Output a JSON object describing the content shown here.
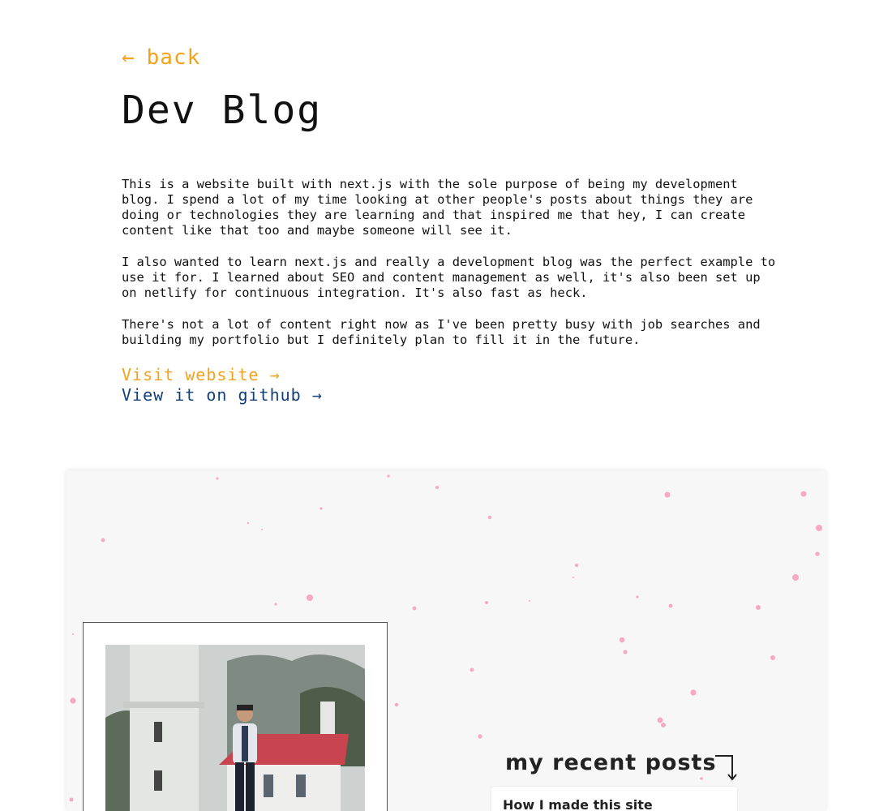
{
  "nav": {
    "back_arrow": "←",
    "back_label": "back"
  },
  "page": {
    "title": "Dev Blog"
  },
  "description": {
    "paragraphs": [
      "This is a website built with next.js with the sole purpose of being my development blog. I spend a lot of my time looking at other people's posts about things they are doing or technologies they are learning and that inspired me that hey, I can create content like that too and maybe someone will see it.",
      "I also wanted to learn next.js and really a development blog was the perfect example to use it for. I learned about SEO and content management as well, it's also been set up on netlify for continuous integration. It's also fast as heck.",
      "There's not a lot of content right now as I've been pretty busy with job searches and building my portfolio but I definitely plan to fill it in the future."
    ]
  },
  "links": {
    "website": "Visit website →",
    "github": "View it on github →"
  },
  "preview": {
    "recent_posts_heading": "my recent posts",
    "recent_posts": [
      {
        "title": "How I made this site"
      }
    ]
  },
  "colors": {
    "accent": "#f4a21a",
    "link_dark": "#123f7a",
    "dot_pink": "#f7a8c4",
    "preview_bg": "#f7f7f7"
  },
  "icons": {
    "back": "arrow-left-icon",
    "external": "arrow-right-icon",
    "corner": "corner-down-right-arrow-icon"
  }
}
